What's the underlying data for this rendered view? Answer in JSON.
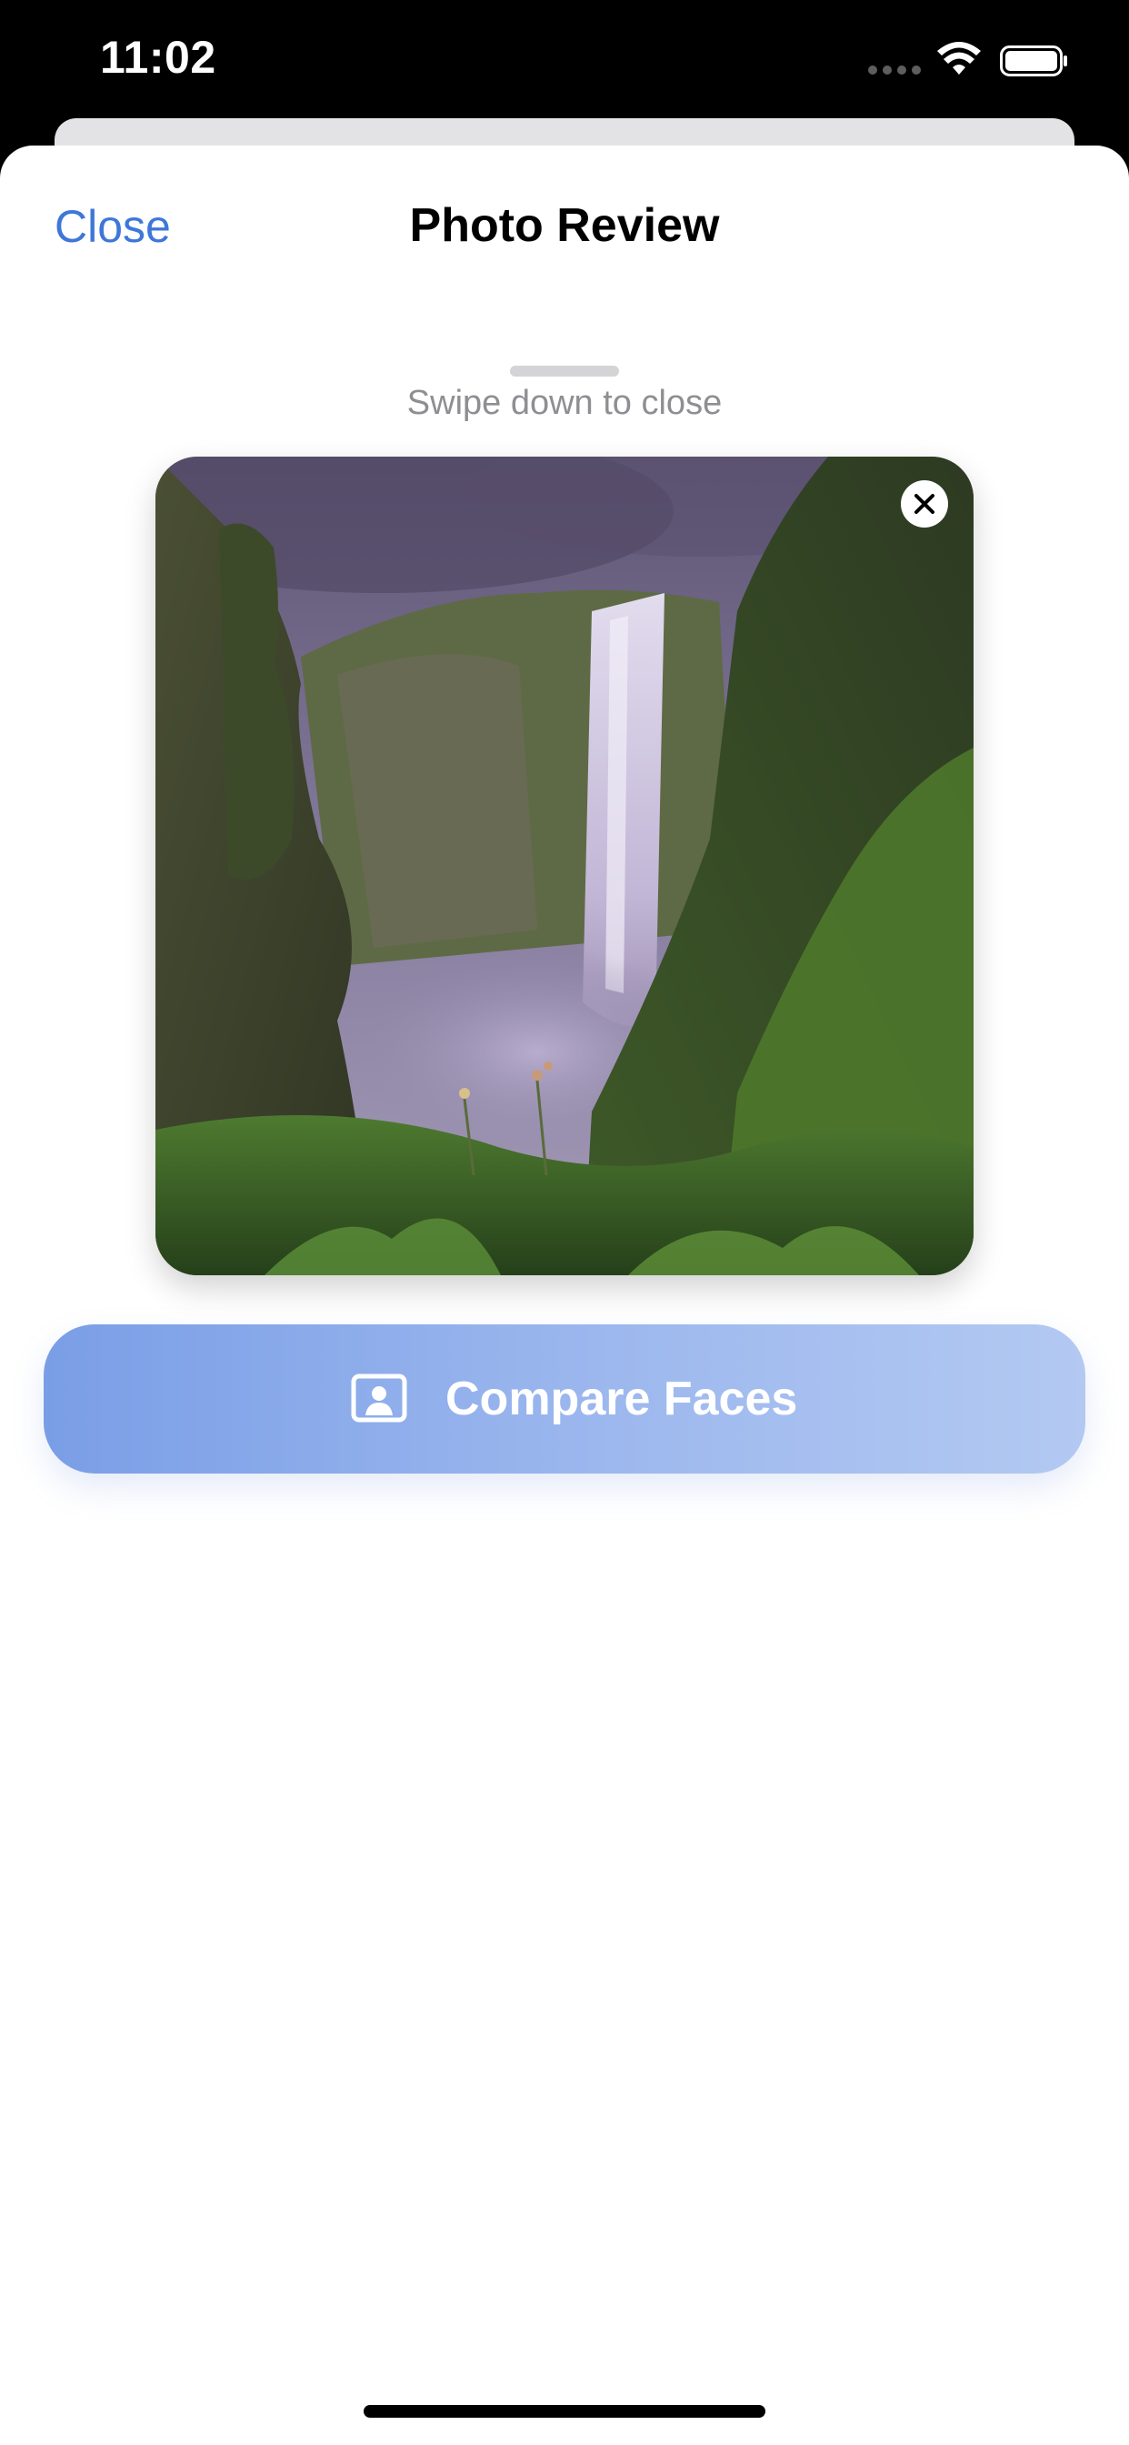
{
  "status_bar": {
    "time": "11:02",
    "icons": [
      "signal-icon",
      "wifi-icon",
      "battery-icon"
    ]
  },
  "nav": {
    "close_label": "Close",
    "title": "Photo Review"
  },
  "sheet": {
    "swipe_hint": "Swipe down to close"
  },
  "photo": {
    "subject": "waterfall landscape",
    "remove_icon": "close-icon"
  },
  "actions": {
    "compare_label": "Compare Faces",
    "compare_icon": "portrait-icon"
  },
  "colors": {
    "accent": "#3f77d9",
    "button_start": "#7a9ee6",
    "button_end": "#b3c9f2",
    "hint_text": "#8e8e93"
  }
}
